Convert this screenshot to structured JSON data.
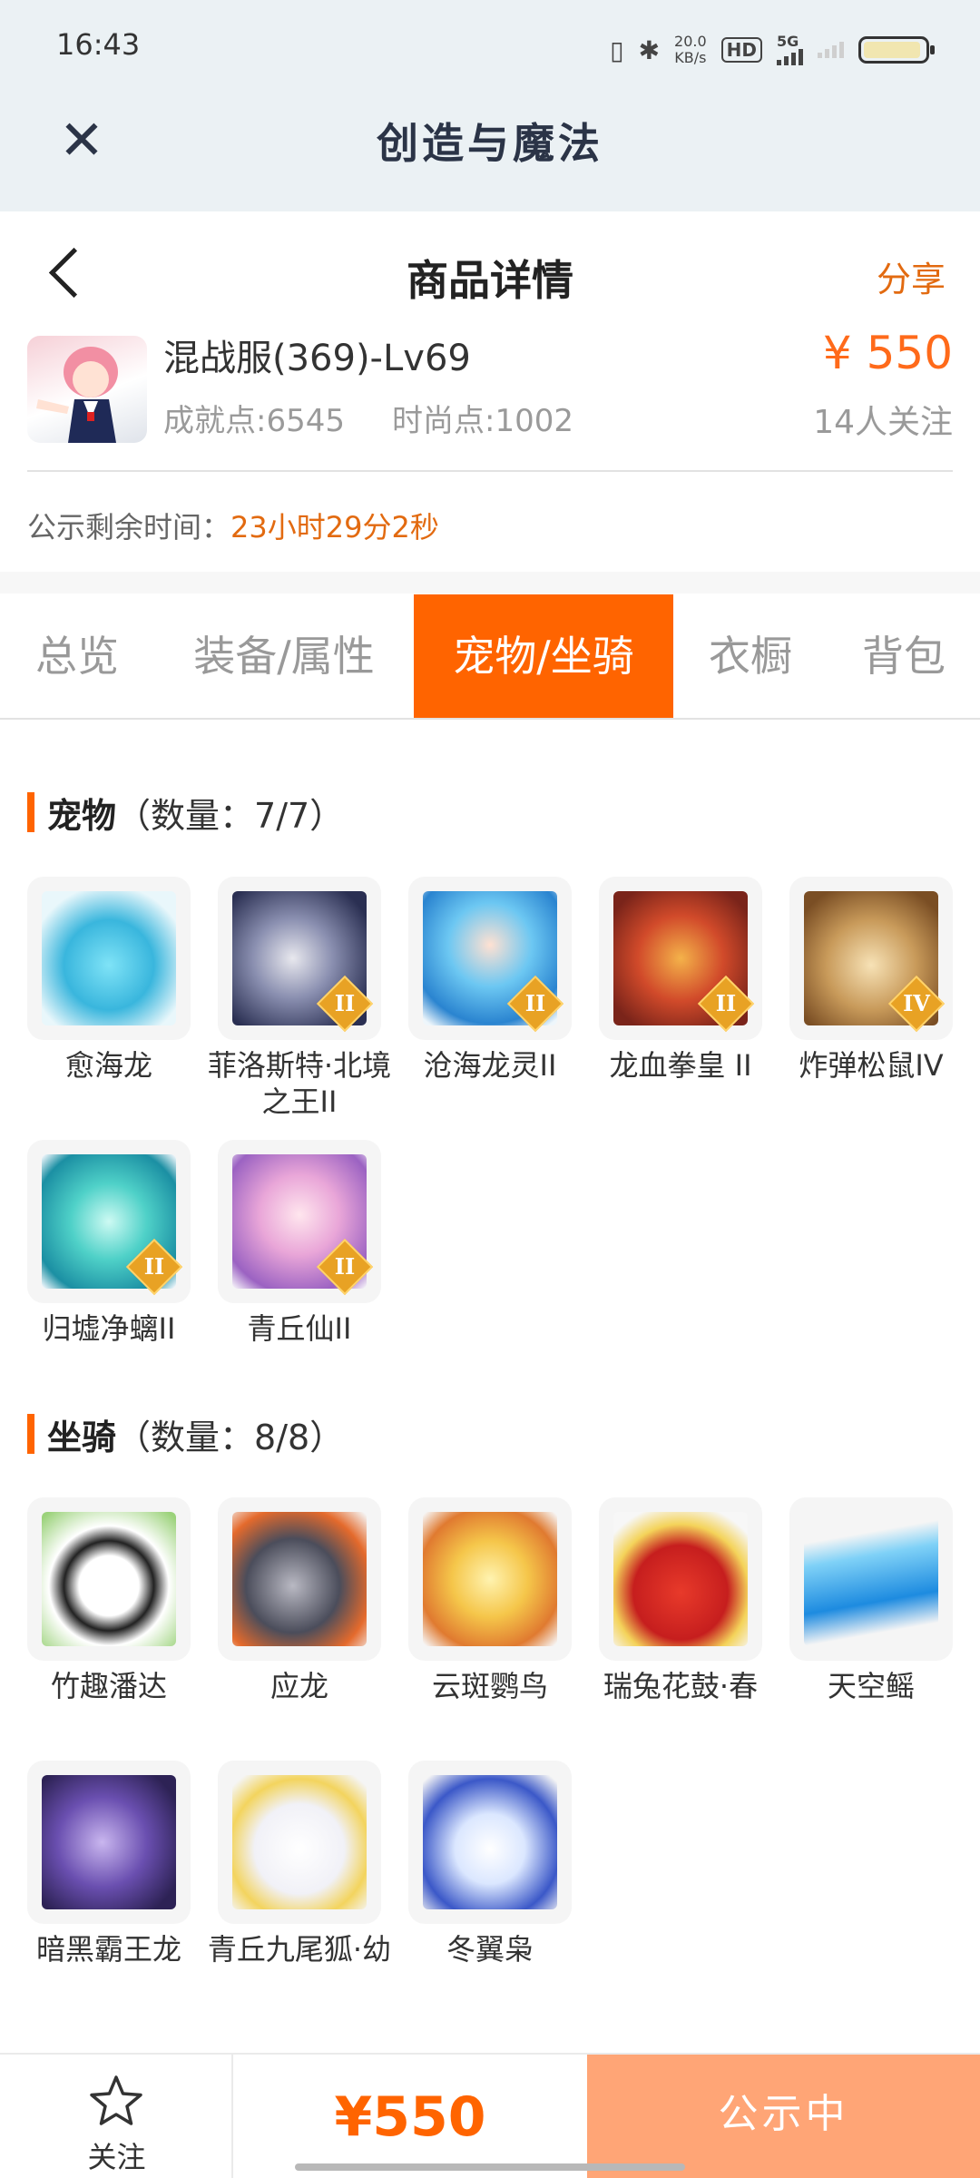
{
  "status_bar": {
    "time": "16:43",
    "speed_top": "20.0",
    "speed_bottom": "KB/s",
    "hd": "HD",
    "net": "5G"
  },
  "app_bar": {
    "title": "创造与魔法"
  },
  "page_header": {
    "title": "商品详情",
    "share": "分享"
  },
  "product": {
    "name": "混战服(369)-Lv69",
    "price": "¥ 550",
    "achievement": "成就点:6545",
    "fashion": "时尚点:1002",
    "followers": "14人关注",
    "countdown_label": "公示剩余时间：",
    "countdown_value": "23小时29分2秒"
  },
  "tabs": [
    "总览",
    "装备/属性",
    "宠物/坐骑",
    "衣橱",
    "背包"
  ],
  "active_tab": 2,
  "pets": {
    "title": "宠物",
    "count": "（数量：7/7）",
    "items": [
      {
        "name": "愈海龙",
        "badge": ""
      },
      {
        "name": "菲洛斯特·北境之王II",
        "badge": "II"
      },
      {
        "name": "沧海龙灵II",
        "badge": "II"
      },
      {
        "name": "龙血拳皇 II",
        "badge": "II"
      },
      {
        "name": "炸弹松鼠IV",
        "badge": "IV"
      },
      {
        "name": "归墟净螭II",
        "badge": "II"
      },
      {
        "name": "青丘仙II",
        "badge": "II"
      }
    ]
  },
  "mounts": {
    "title": "坐骑",
    "count": "（数量：8/8）",
    "items": [
      {
        "name": "竹趣潘达"
      },
      {
        "name": "应龙"
      },
      {
        "name": "云斑鹦鸟"
      },
      {
        "name": "瑞兔花鼓·春"
      },
      {
        "name": "天空鳐"
      },
      {
        "name": "暗黑霸王龙"
      },
      {
        "name": "青丘九尾狐·幼"
      },
      {
        "name": "冬翼枭"
      }
    ]
  },
  "bottom": {
    "follow": "关注",
    "price": "¥550",
    "status": "公示中"
  },
  "colors": {
    "accent": "#ff6400",
    "price": "#ff6a1a",
    "status_button": "#ffa576"
  }
}
